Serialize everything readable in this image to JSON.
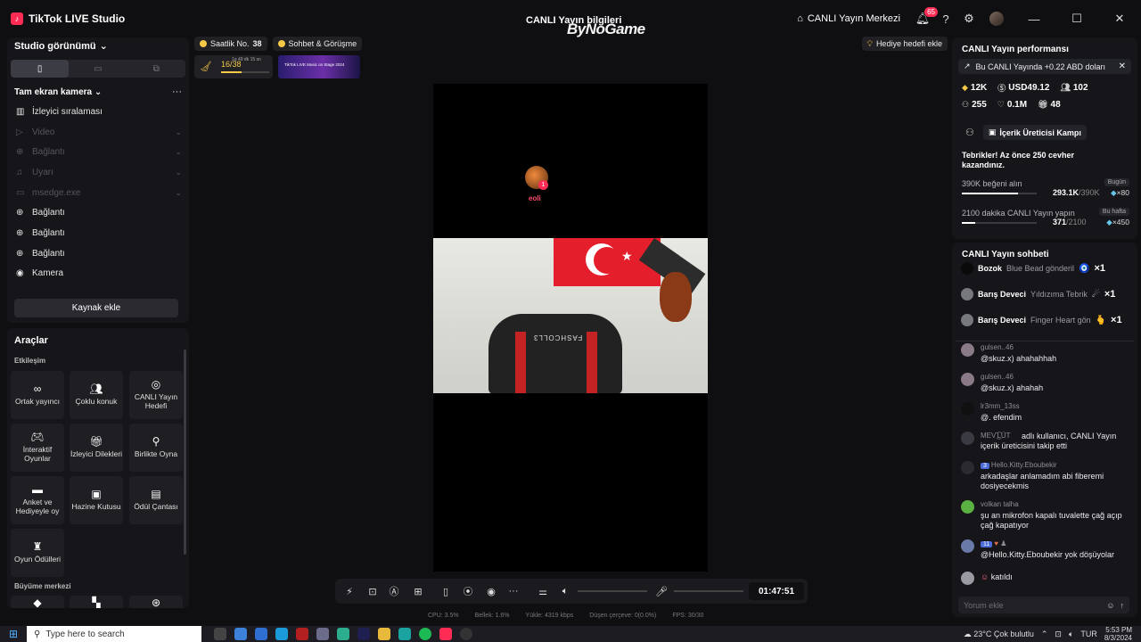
{
  "app": {
    "title": "TikTok LIVE Studio",
    "center_title": "CANLI Yayın bilgileri",
    "watermark": "ByNoGame",
    "live_center": "CANLI Yayın Merkezi",
    "notif_count": "65"
  },
  "studio": {
    "header": "Studio görünümü",
    "scene": "Tam ekran kamera",
    "sources": [
      {
        "label": "İzleyici sıralaması",
        "icon": "ranking-icon",
        "dim": false
      },
      {
        "label": "Video",
        "icon": "play-icon",
        "dim": true
      },
      {
        "label": "Bağlantı",
        "icon": "link-icon",
        "dim": true
      },
      {
        "label": "Uyarı",
        "icon": "bell-icon",
        "dim": true
      },
      {
        "label": "msedge.exe",
        "icon": "window-icon",
        "dim": true
      },
      {
        "label": "Bağlantı",
        "icon": "globe-icon",
        "dim": false
      },
      {
        "label": "Bağlantı",
        "icon": "globe-icon",
        "dim": false
      },
      {
        "label": "Bağlantı",
        "icon": "globe-icon",
        "dim": false
      },
      {
        "label": "Kamera",
        "icon": "camera-icon",
        "dim": false
      }
    ],
    "add_source": "Kaynak ekle"
  },
  "tools": {
    "title": "Araçlar",
    "section_interaction": "Etkileşim",
    "section_growth": "Büyüme merkezi",
    "items": [
      {
        "label": "Ortak yayıncı",
        "icon": "cohost-icon"
      },
      {
        "label": "Çoklu konuk",
        "icon": "multi-guest-icon"
      },
      {
        "label": "CANLI Yayın Hedefi",
        "icon": "target-icon"
      },
      {
        "label": "İnteraktif Oyunlar",
        "icon": "gamepad-icon"
      },
      {
        "label": "İzleyici Dilekleri",
        "icon": "gift-icon"
      },
      {
        "label": "Birlikte Oyna",
        "icon": "joystick-icon"
      },
      {
        "label": "Anket ve Hediyeyle oy",
        "icon": "poll-icon"
      },
      {
        "label": "Hazine Kutusu",
        "icon": "treasure-icon"
      },
      {
        "label": "Ödül Çantası",
        "icon": "bag-icon"
      },
      {
        "label": "Oyun Ödülleri",
        "icon": "trophy-icon"
      }
    ]
  },
  "chips": {
    "hourly": "Saatlik No.",
    "hourly_value": "38",
    "chat_call": "Sohbet & Görüşme",
    "goal_progress": "16/38",
    "goal_time": "1g 49 dk 15 sn",
    "banner_text": "TikTok LIVE Music on Stage 2024",
    "gift_goal": "Hediye hedefi ekle"
  },
  "overlay": {
    "name": "eoli",
    "badge": "1"
  },
  "camera": {
    "chair_text": "FASHCOLL3"
  },
  "controls": {
    "timer": "01:47:51"
  },
  "stats": {
    "cpu": "CPU: 3.5%",
    "memory": "Bellek: 1.6%",
    "upload": "Yükle: 4319 kbps",
    "dropped": "Düşen çerçeve: 0(0.0%)",
    "fps": "FPS: 30/30"
  },
  "performance": {
    "title": "CANLI Yayın performansı",
    "note": "Bu CANLI Yayında +0.22 ABD doları",
    "stats_row1": [
      {
        "icon": "diamond-icon",
        "value": "12K"
      },
      {
        "icon": "dollar-icon",
        "value": "USD49.12"
      },
      {
        "icon": "viewers-icon",
        "value": "102"
      }
    ],
    "stats_row2": [
      {
        "icon": "new-follower-icon",
        "value": "255"
      },
      {
        "icon": "heart-icon",
        "value": "0.1M"
      },
      {
        "icon": "gift-icon",
        "value": "48"
      }
    ],
    "camp_label": "İçerik Üreticisi Kampı",
    "congrats": "Tebrikler! Az önce 250 cevher kazandınız.",
    "tasks": [
      {
        "label": "390K beğeni alın",
        "badge": "Bugün",
        "progress": "293.1K",
        "total": "/390K",
        "reward": "×80",
        "fraction": 0.75
      },
      {
        "label": "2100 dakika CANLI Yayın yapın",
        "badge": "Bu hafta",
        "progress": "371",
        "total": "/2100",
        "reward": "×450",
        "fraction": 0.18
      }
    ]
  },
  "chat": {
    "title": "CANLI Yayın sohbeti",
    "gifts": [
      {
        "name": "Bozok",
        "desc": "Blue Bead gönderildi",
        "icon": "🧿",
        "mult": "×1"
      },
      {
        "name": "Barış Deveci",
        "desc": "Yıldızıma Tebrik",
        "icon": "☄",
        "mult": "×1"
      },
      {
        "name": "Barış Deveci",
        "desc": "Finger Heart gön",
        "icon": "🫰",
        "mult": "×1"
      }
    ],
    "messages": [
      {
        "name": "gulsen..46",
        "text": "@skuz.x) ahahahhah",
        "level": "",
        "color": "#8a7a88"
      },
      {
        "name": "gulsen..46",
        "text": "@skuz.x) ahahah",
        "level": "",
        "color": "#8a7a88"
      },
      {
        "name": "lr3mm_13ss",
        "text": "@. efendim",
        "level": "",
        "color": "#101010"
      },
      {
        "name": "MEѴ͜͡LÜT",
        "text": "adlı kullanıcı, CANLI Yayın içerik üreticisini takip etti",
        "level": "",
        "color": "#3a3a42"
      },
      {
        "name": "Hello.Kitty.Eboubekir",
        "text": "arkadaşlar anlamadım abi fiberemi dosiyecekmis",
        "level": "3",
        "color": "#2a2a30"
      },
      {
        "name": "volkan talha",
        "text": "şu an mikrofon kapalı tuvalette çağ açıp çağ kapatıyor",
        "level": "",
        "color": "#5ab040"
      },
      {
        "name": "",
        "text": "@Hello.Kitty.Eboubekir yok döşüyolar",
        "level": "11",
        "color": "#6a7aa8"
      },
      {
        "name": "",
        "text": "katıldı",
        "level": "",
        "color": "#9a9aa2"
      }
    ],
    "input_placeholder": "Yorum ekle"
  },
  "taskbar": {
    "search_placeholder": "Type here to search",
    "weather": "23°C Çok bulutlu",
    "lang": "TUR",
    "time": "5:53 PM",
    "date": "8/3/2024"
  },
  "colors": {
    "accent": "#fe2c55",
    "gold": "#f7c948",
    "panel": "#16161a"
  }
}
